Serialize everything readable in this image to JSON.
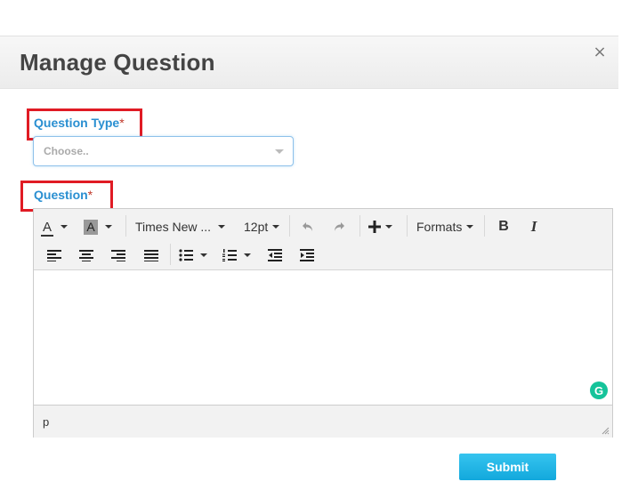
{
  "modal": {
    "title": "Manage Question",
    "close_label": "×"
  },
  "form": {
    "question_type": {
      "label": "Question Type",
      "required_mark": "*",
      "placeholder": "Choose.."
    },
    "question": {
      "label": "Question",
      "required_mark": "*"
    },
    "submit_label": "Submit"
  },
  "editor": {
    "text_color_label": "A",
    "bg_color_label": "A",
    "font_family": "Times New ...",
    "font_size": "12pt",
    "formats_label": "Formats",
    "bold_label": "B",
    "italic_label": "I",
    "status_path": "p",
    "grammarly_label": "G"
  },
  "colors": {
    "label_blue": "#2a8fd1",
    "highlight_red": "#e01b24",
    "submit_blue": "#1aaee0",
    "grammarly_green": "#15c39a"
  }
}
